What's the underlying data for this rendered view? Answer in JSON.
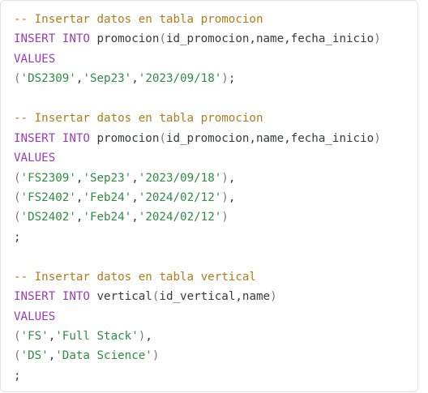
{
  "theme": {
    "comment_color": "#b07b1c",
    "keyword_color": "#9a3ab8",
    "string_color": "#2e8c43",
    "text_color": "#383a42"
  },
  "code": {
    "block1": {
      "comment": "-- Insertar datos en tabla promocion",
      "insert_kw": "INSERT INTO",
      "table": "promocion",
      "columns": "id_promocion,name,fecha_inicio",
      "values_kw": "VALUES",
      "rows": [
        [
          "'DS2309'",
          "'Sep23'",
          "'2023/09/18'"
        ]
      ]
    },
    "block2": {
      "comment": "-- Insertar datos en tabla promocion",
      "insert_kw": "INSERT INTO",
      "table": "promocion",
      "columns": "id_promocion,name,fecha_inicio",
      "values_kw": "VALUES",
      "rows": [
        [
          "'FS2309'",
          "'Sep23'",
          "'2023/09/18'"
        ],
        [
          "'FS2402'",
          "'Feb24'",
          "'2024/02/12'"
        ],
        [
          "'DS2402'",
          "'Feb24'",
          "'2024/02/12'"
        ]
      ],
      "terminator": ";"
    },
    "block3": {
      "comment": "-- Insertar datos en tabla vertical",
      "insert_kw": "INSERT INTO",
      "table": "vertical",
      "columns": "id_vertical,name",
      "values_kw": "VALUES",
      "rows": [
        [
          "'FS'",
          "'Full Stack'"
        ],
        [
          "'DS'",
          "'Data Science'"
        ]
      ],
      "terminator": ";"
    }
  }
}
